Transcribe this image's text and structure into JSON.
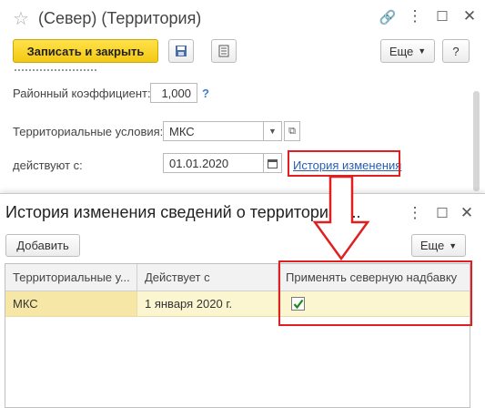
{
  "main": {
    "title": "(Север) (Территория)",
    "toolbar": {
      "save_close_label": "Записать и закрыть",
      "more_label": "Еще",
      "help_label": "?"
    },
    "form": {
      "coef_label": "Районный коэффициент:",
      "coef_value": "1,000",
      "coef_help": "?",
      "terr_label": "Территориальные условия:",
      "terr_value": "МКС",
      "date_label": "действуют с:",
      "date_value": "01.01.2020",
      "history_link": "История изменения"
    }
  },
  "dialog": {
    "title": "История изменения сведений о территориал...",
    "add_label": "Добавить",
    "more_label": "Еще",
    "columns": [
      "Территориальные у...",
      "Действует с",
      "Применять северную надбавку"
    ],
    "rows": [
      {
        "terr": "МКС",
        "date": "1 января 2020 г.",
        "north": true
      }
    ]
  },
  "colors": {
    "accent_yellow": "#f3c813",
    "annotation_red": "#e02020",
    "link_blue": "#2a5db0"
  }
}
